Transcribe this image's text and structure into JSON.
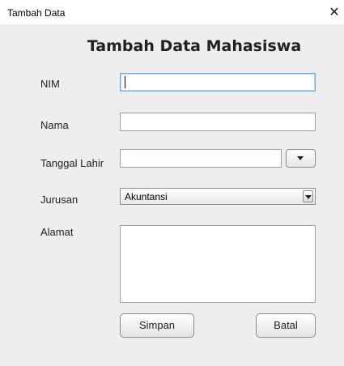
{
  "window": {
    "title": "Tambah Data",
    "close_glyph": "✕"
  },
  "heading": "Tambah Data Mahasiswa",
  "fields": {
    "nim_label": "NIM",
    "nim_value": "",
    "nama_label": "Nama",
    "nama_value": "",
    "tanggal_label": "Tanggal Lahir",
    "tanggal_value": "",
    "jurusan_label": "Jurusan",
    "jurusan_selected": "Akuntansi",
    "alamat_label": "Alamat",
    "alamat_value": ""
  },
  "buttons": {
    "simpan": "Simpan",
    "batal": "Batal"
  }
}
